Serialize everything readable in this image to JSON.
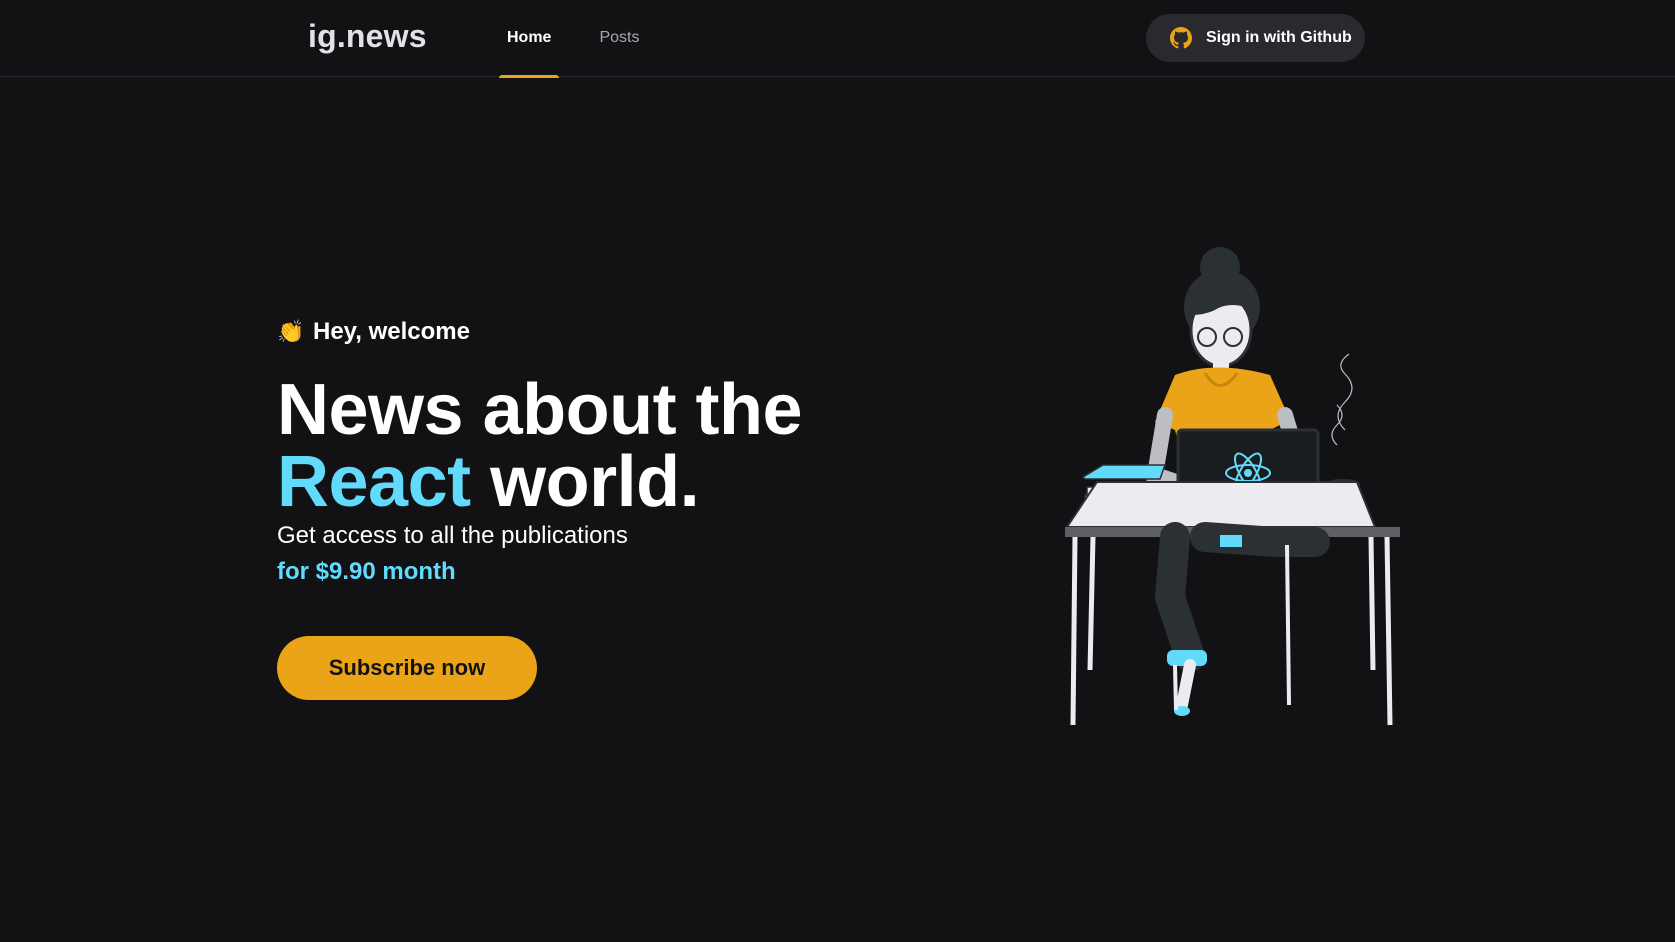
{
  "header": {
    "logo": "ig.news",
    "nav": [
      {
        "label": "Home",
        "active": true
      },
      {
        "label": "Posts",
        "active": false
      }
    ],
    "signin_label": "Sign in with Github",
    "signin_icon": "github-icon",
    "accent": "#eba417"
  },
  "hero": {
    "welcome_emoji": "👏",
    "welcome_text": "Hey, welcome",
    "title_line1": "News about the",
    "title_react": "React",
    "title_line2_rest": "world.",
    "subtitle": "Get access to all the publications",
    "price": "for $9.90 month",
    "cta_label": "Subscribe now"
  },
  "colors": {
    "background": "#121214",
    "header_border": "#29292e",
    "button_dark": "#29292e",
    "accent_yellow": "#eba417",
    "react_cyan": "#61dafb",
    "text": "#ffffff"
  },
  "illustration": {
    "icon": "woman-with-laptop-illustration"
  }
}
